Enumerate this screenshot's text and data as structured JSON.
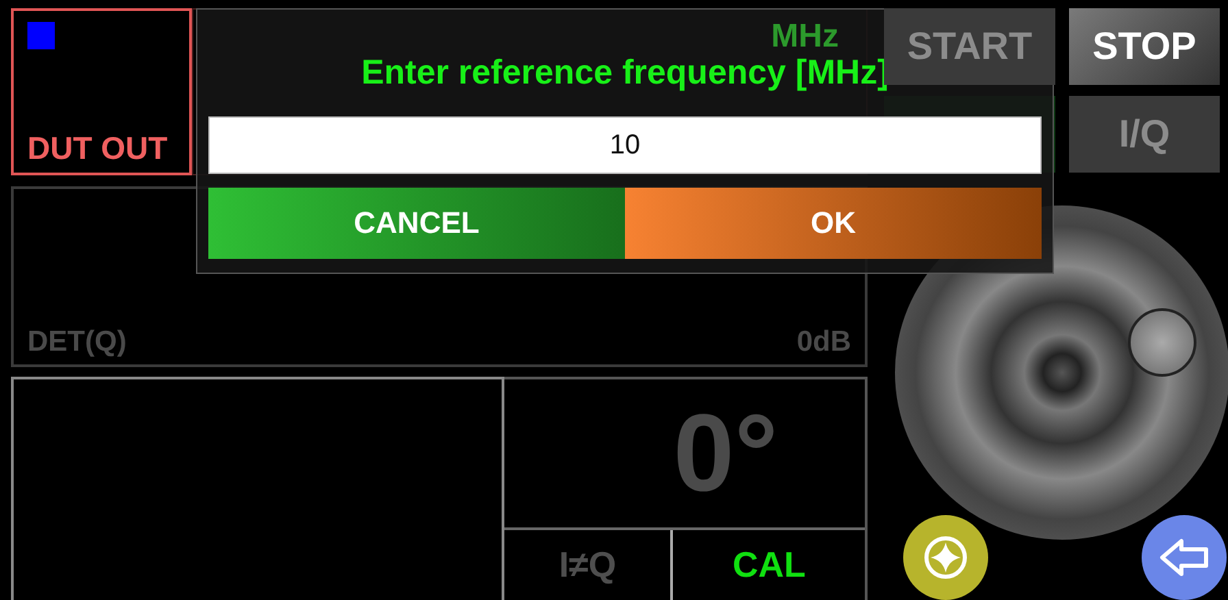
{
  "status": {
    "label": "DUT OUT"
  },
  "frequency": {
    "unit": "MHz"
  },
  "detector": {
    "label": "DET(Q)",
    "gain": "0dB"
  },
  "phase": {
    "reading": "0°"
  },
  "mode_buttons": [
    {
      "label": "I≠Q",
      "active": false
    },
    {
      "label": "CAL",
      "active": true
    }
  ],
  "controls": [
    {
      "label": "START",
      "enabled": false
    },
    {
      "label": "STOP",
      "enabled": true
    },
    {
      "label": "I/Q",
      "enabled": false
    }
  ],
  "dialog": {
    "title": "Enter reference frequency [MHz]",
    "value": "10",
    "buttons": [
      {
        "label": "CANCEL",
        "kind": "cancel"
      },
      {
        "label": "OK",
        "kind": "ok"
      }
    ]
  }
}
